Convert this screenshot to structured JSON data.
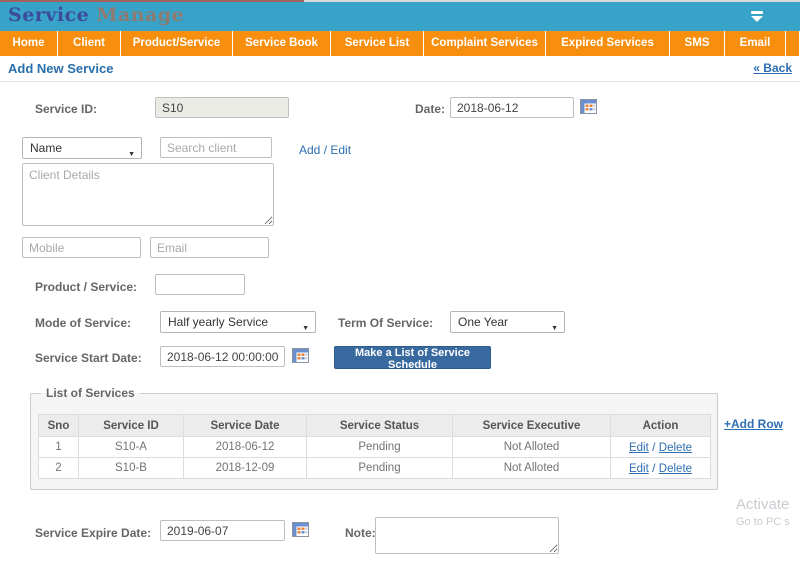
{
  "header": {
    "title_part1": "Service",
    "title_part2": " Manage"
  },
  "nav": {
    "items": [
      "Home",
      "Client",
      "Product/Service",
      "Service Book",
      "Service List",
      "Complaint Services",
      "Expired Services",
      "SMS",
      "Email"
    ]
  },
  "page": {
    "heading": "Add New Service",
    "back_link": "« Back"
  },
  "form": {
    "service_id": {
      "label": "Service ID:",
      "value": "S10"
    },
    "date": {
      "label": "Date:",
      "value": "2018-06-12"
    },
    "client_search": {
      "selected_type": "Name",
      "placeholder": "Search client",
      "add_label": "Add",
      "separator": " / ",
      "edit_label": "Edit"
    },
    "client_details_placeholder": "Client Details",
    "mobile_placeholder": "Mobile",
    "email_placeholder": "Email",
    "product_service": {
      "label": "Product / Service:",
      "value": ""
    },
    "mode_of_service": {
      "label": "Mode of Service:",
      "selected": "Half yearly Service"
    },
    "term_of_service": {
      "label": "Term Of Service:",
      "selected": "One Year"
    },
    "service_start_date": {
      "label": "Service Start Date:",
      "value": "2018-06-12 00:00:00"
    },
    "make_list_button": "Make a List of Service Schedule",
    "service_expire_date": {
      "label": "Service Expire Date:",
      "value": "2019-06-07"
    },
    "note_label": "Note:"
  },
  "services_table": {
    "legend": "List of Services",
    "add_row_link": "+Add Row",
    "columns": [
      "Sno",
      "Service ID",
      "Service Date",
      "Service Status",
      "Service Executive",
      "Action"
    ],
    "action_separator": " / ",
    "rows": [
      {
        "sno": "1",
        "service_id": "S10-A",
        "service_date": "2018-06-12",
        "status": "Pending",
        "executive": "Not Alloted",
        "edit": "Edit",
        "delete": "Delete"
      },
      {
        "sno": "2",
        "service_id": "S10-B",
        "service_date": "2018-12-09",
        "status": "Pending",
        "executive": "Not Alloted",
        "edit": "Edit",
        "delete": "Delete"
      }
    ]
  },
  "watermark": {
    "line1": "Activate",
    "line2": "Go to PC s"
  },
  "icons": {
    "select_arrow_glyph": "▼",
    "calendar": "calendar-icon",
    "dropdown": "dropdown-icon"
  },
  "colors": {
    "header_teal": "#38a3c8",
    "nav_orange": "#f78e0d",
    "title_blue": "#3d4b9b",
    "title_gray": "#8d7b72",
    "link_blue": "#2f6eb2",
    "button_blue": "#38699f"
  }
}
